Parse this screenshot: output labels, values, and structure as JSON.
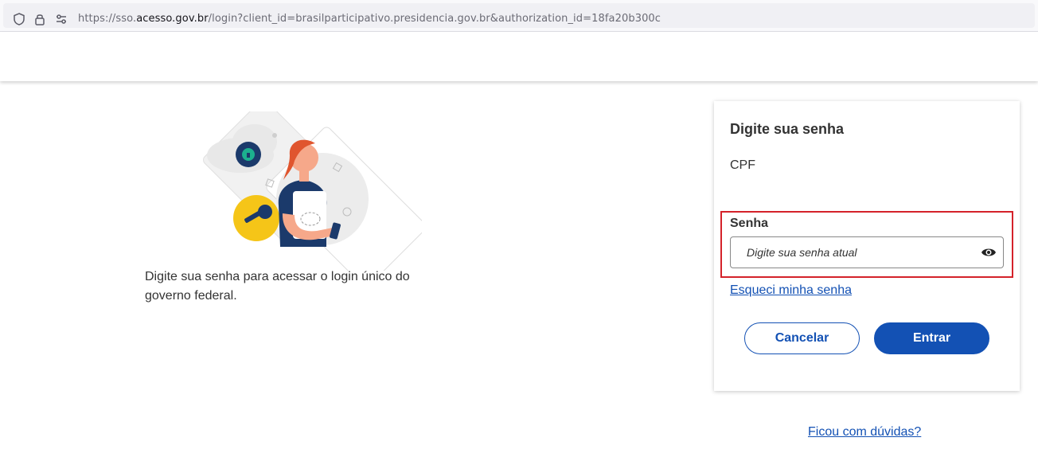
{
  "browser": {
    "url_prefix": "https://sso.",
    "url_host": "acesso.gov.br",
    "url_rest": "/login?client_id=brasilparticipativo.presidencia.gov.br&authorization_id=18fa20b300c"
  },
  "left": {
    "description": "Digite sua senha para acessar o login único do governo federal."
  },
  "card": {
    "title": "Digite sua senha",
    "cpf_label": "CPF",
    "senha_label": "Senha",
    "senha_placeholder": "Digite sua senha atual",
    "forgot_link": "Esqueci minha senha",
    "cancel_button": "Cancelar",
    "enter_button": "Entrar"
  },
  "footer": {
    "help_link": "Ficou com dúvidas?"
  },
  "colors": {
    "primary": "#1351b4",
    "highlight": "#d4222a"
  }
}
